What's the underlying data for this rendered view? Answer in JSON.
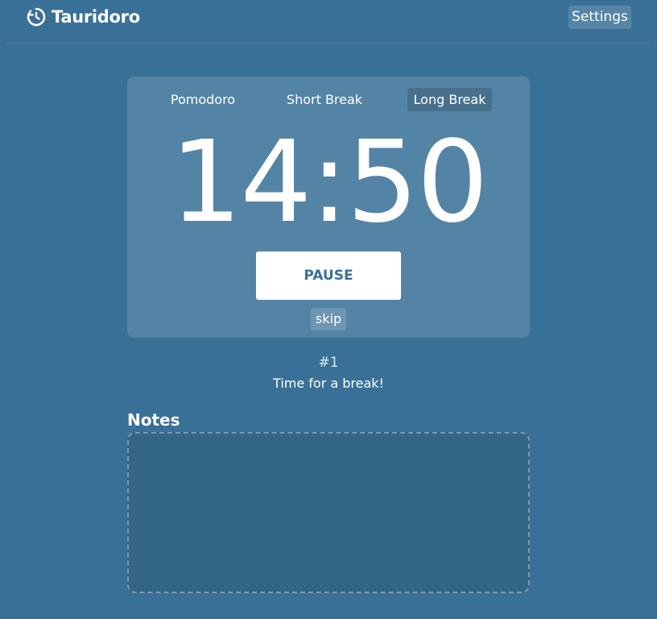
{
  "app": {
    "title": "Tauridoro",
    "logo_icon": "clock-icon"
  },
  "header": {
    "settings_label": "Settings"
  },
  "timer_card": {
    "modes": [
      {
        "label": "Pomodoro",
        "active": false
      },
      {
        "label": "Short Break",
        "active": false
      },
      {
        "label": "Long Break",
        "active": true
      }
    ],
    "time": "14:50",
    "pause_label": "PAUSE",
    "skip_label": "skip"
  },
  "status": {
    "round": "#1",
    "message": "Time for a break!"
  },
  "notes": {
    "title": "Notes",
    "value": ""
  },
  "colors": {
    "background": "#397097",
    "notes_background": "#336685",
    "text": "#ffffff"
  }
}
